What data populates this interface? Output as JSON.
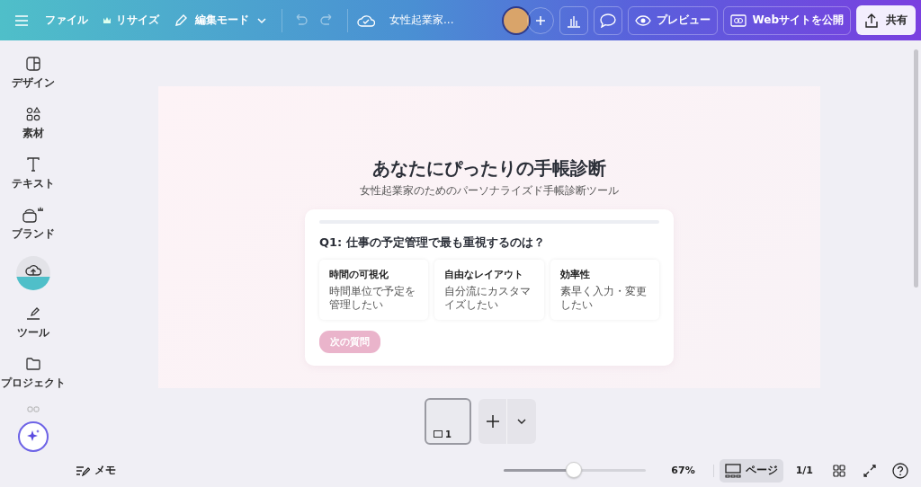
{
  "toolbar": {
    "file": "ファイル",
    "resize": "リサイズ",
    "edit_mode": "編集モード",
    "doc_title": "女性起業家...",
    "preview": "プレビュー",
    "publish": "Webサイトを公開",
    "share": "共有"
  },
  "sidebar": {
    "items": [
      {
        "kind": "design",
        "label": "デザイン"
      },
      {
        "kind": "elements",
        "label": "素材"
      },
      {
        "kind": "text",
        "label": "テキスト"
      },
      {
        "kind": "brand",
        "label": "ブランド"
      },
      {
        "kind": "upload"
      },
      {
        "kind": "tools",
        "label": "ツール"
      },
      {
        "kind": "projects",
        "label": "プロジェクト"
      },
      {
        "kind": "apps"
      }
    ]
  },
  "page": {
    "title": "あなたにぴったりの手帳診断",
    "subtitle": "女性起業家のためのパーソナライズド手帳診断ツール",
    "card": {
      "question": "Q1: 仕事の予定管理で最も重視するのは？",
      "options": [
        {
          "title": "時間の可視化",
          "description": "時間単位で予定を管理したい",
          "selected": false
        },
        {
          "title": "自由なレイアウト",
          "description": "自分流にカスタマイズしたい",
          "selected": false
        },
        {
          "title": "効率性",
          "description": "素早く入力・変更したい",
          "selected": false
        }
      ],
      "next": {
        "label": "次の質問",
        "disabled": true
      }
    }
  },
  "pages_strip": {
    "thumbnails": [
      {
        "number": "1",
        "selected": true
      }
    ]
  },
  "bottom_bar": {
    "notes": "メモ",
    "zoom": {
      "level": 0.49,
      "reading": "67%"
    },
    "pages_button": "ページ",
    "page_count": "1/1"
  }
}
